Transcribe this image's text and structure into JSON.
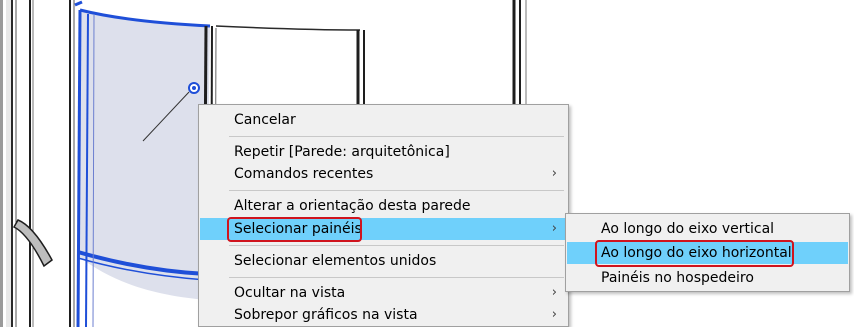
{
  "context_menu": {
    "items": [
      {
        "label": "Cancelar"
      },
      {
        "label": "Repetir [Parede: arquitetônica]"
      },
      {
        "label": "Comandos recentes",
        "submenu": true
      },
      {
        "label": "Alterar a orientação desta parede"
      },
      {
        "label": "Selecionar painéis",
        "submenu": true,
        "highlighted": true
      },
      {
        "label": "Selecionar elementos unidos"
      },
      {
        "label": "Ocultar na vista",
        "submenu": true
      },
      {
        "label": "Sobrepor gráficos na vista",
        "submenu": true
      }
    ],
    "arrow_glyph": "›"
  },
  "submenu": {
    "items": [
      {
        "label": "Ao longo do eixo vertical"
      },
      {
        "label": "Ao longo do eixo horizontal",
        "highlighted": true
      },
      {
        "label": "Painéis no hospedeiro"
      }
    ]
  },
  "colors": {
    "highlight": "#6fd0fb",
    "annotation_red": "#d0141e",
    "selection_blue": "#1f4fd8",
    "panel_fill": "#dde0ec"
  },
  "icons": [
    "grip-handle-icon",
    "submenu-arrow-icon"
  ]
}
